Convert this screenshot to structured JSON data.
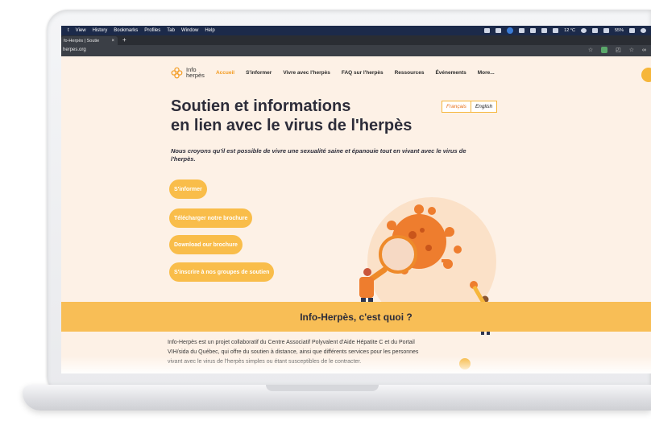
{
  "menubar": {
    "items": [
      "t",
      "View",
      "History",
      "Bookmarks",
      "Profiles",
      "Tab",
      "Window",
      "Help"
    ],
    "status": {
      "weather": "12 °C",
      "battery": "55%"
    }
  },
  "browser": {
    "tab_title": "fo-Herpès | Soutie",
    "tab_close": "×",
    "new_tab": "+",
    "url": "herpes.org"
  },
  "nav": {
    "logo_line1": "Info",
    "logo_line2": "herpès",
    "links": [
      "Accueil",
      "S'informer",
      "Vivre avec l'herpès",
      "FAQ sur l'herpès",
      "Ressources",
      "Événements",
      "More..."
    ]
  },
  "hero": {
    "title_line1": "Soutien et informations",
    "title_line2": "en lien avec le virus de l'herpès",
    "subtitle": "Nous croyons qu'il est possible de vivre une sexualité saine et épanouie tout en vivant avec le virus de l'herpès.",
    "lang_fr": "Français",
    "lang_en": "English",
    "cta": [
      "S'informer",
      "Télécharger notre brochure",
      "Download our brochure",
      "S'inscrire à nos groupes de soutien"
    ]
  },
  "band": {
    "title": "Info-Herpès, c'est quoi ?"
  },
  "about": {
    "text": "Info-Herpès est un projet collaboratif du Centre Associatif Polyvalent d'Aide Hépatite C et du Portail VIH/sida du Québec, qui offre du soutien à distance, ainsi que différents services pour les personnes vivant avec le virus de l'herpès simples ou étant susceptibles de le contracter."
  },
  "colors": {
    "accent": "#f39a1e",
    "button": "#f9bd4a",
    "band": "#f8be56",
    "page_bg": "#fdf1e6"
  }
}
